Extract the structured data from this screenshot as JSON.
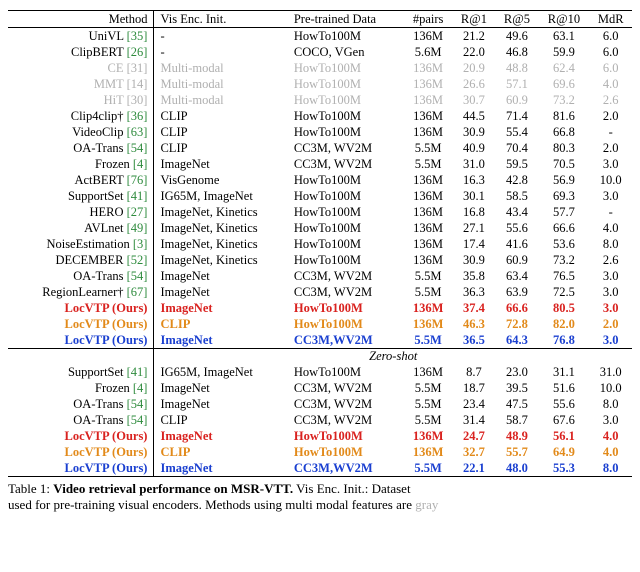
{
  "chart_data": {
    "type": "table",
    "title": "Video retrieval performance on MSR-VTT",
    "columns": [
      "Method",
      "Vis Enc. Init.",
      "Pre-trained Data",
      "#pairs",
      "R@1",
      "R@5",
      "R@10",
      "MdR"
    ],
    "rows_upper": [
      {
        "style": "",
        "method": "UniVL",
        "ref": "[35]",
        "init": "-",
        "data": "HowTo100M",
        "pairs": "136M",
        "r1": "21.2",
        "r5": "49.6",
        "r10": "63.1",
        "mdr": "6.0"
      },
      {
        "style": "",
        "method": "ClipBERT",
        "ref": "[26]",
        "init": "-",
        "data": "COCO, VGen",
        "pairs": "5.6M",
        "r1": "22.0",
        "r5": "46.8",
        "r10": "59.9",
        "mdr": "6.0"
      },
      {
        "style": "gray",
        "method": "CE",
        "ref": "[31]",
        "init": "Multi-modal",
        "data": "HowTo100M",
        "pairs": "136M",
        "r1": "20.9",
        "r5": "48.8",
        "r10": "62.4",
        "mdr": "6.0"
      },
      {
        "style": "gray",
        "method": "MMT",
        "ref": "[14]",
        "init": "Multi-modal",
        "data": "HowTo100M",
        "pairs": "136M",
        "r1": "26.6",
        "r5": "57.1",
        "r10": "69.6",
        "mdr": "4.0"
      },
      {
        "style": "gray",
        "method": "HiT",
        "ref": "[30]",
        "init": "Multi-modal",
        "data": "HowTo100M",
        "pairs": "136M",
        "r1": "30.7",
        "r5": "60.9",
        "r10": "73.2",
        "mdr": "2.6"
      },
      {
        "style": "",
        "method": "Clip4clip†",
        "ref": "[36]",
        "init": "CLIP",
        "data": "HowTo100M",
        "pairs": "136M",
        "r1": "44.5",
        "r5": "71.4",
        "r10": "81.6",
        "mdr": "2.0"
      },
      {
        "style": "",
        "method": "VideoClip",
        "ref": "[63]",
        "init": "CLIP",
        "data": "HowTo100M",
        "pairs": "136M",
        "r1": "30.9",
        "r5": "55.4",
        "r10": "66.8",
        "mdr": "-"
      },
      {
        "style": "",
        "method": "OA-Trans",
        "ref": "[54]",
        "init": "CLIP",
        "data": "CC3M, WV2M",
        "pairs": "5.5M",
        "r1": "40.9",
        "r5": "70.4",
        "r10": "80.3",
        "mdr": "2.0"
      },
      {
        "style": "",
        "method": "Frozen",
        "ref": "[4]",
        "init": "ImageNet",
        "data": "CC3M, WV2M",
        "pairs": "5.5M",
        "r1": "31.0",
        "r5": "59.5",
        "r10": "70.5",
        "mdr": "3.0"
      },
      {
        "style": "",
        "method": "ActBERT",
        "ref": "[76]",
        "init": "VisGenome",
        "data": "HowTo100M",
        "pairs": "136M",
        "r1": "16.3",
        "r5": "42.8",
        "r10": "56.9",
        "mdr": "10.0"
      },
      {
        "style": "",
        "method": "SupportSet",
        "ref": "[41]",
        "init": "IG65M, ImageNet",
        "data": "HowTo100M",
        "pairs": "136M",
        "r1": "30.1",
        "r5": "58.5",
        "r10": "69.3",
        "mdr": "3.0"
      },
      {
        "style": "",
        "method": "HERO",
        "ref": "[27]",
        "init": "ImageNet, Kinetics",
        "data": "HowTo100M",
        "pairs": "136M",
        "r1": "16.8",
        "r5": "43.4",
        "r10": "57.7",
        "mdr": "-"
      },
      {
        "style": "",
        "method": "AVLnet",
        "ref": "[49]",
        "init": "ImageNet, Kinetics",
        "data": "HowTo100M",
        "pairs": "136M",
        "r1": "27.1",
        "r5": "55.6",
        "r10": "66.6",
        "mdr": "4.0"
      },
      {
        "style": "",
        "method": "NoiseEstimation",
        "ref": "[3]",
        "init": "ImageNet, Kinetics",
        "data": "HowTo100M",
        "pairs": "136M",
        "r1": "17.4",
        "r5": "41.6",
        "r10": "53.6",
        "mdr": "8.0"
      },
      {
        "style": "",
        "method": "DECEMBER",
        "ref": "[52]",
        "init": "ImageNet, Kinetics",
        "data": "HowTo100M",
        "pairs": "136M",
        "r1": "30.9",
        "r5": "60.9",
        "r10": "73.2",
        "mdr": "2.6"
      },
      {
        "style": "",
        "method": "OA-Trans",
        "ref": "[54]",
        "init": "ImageNet",
        "data": "CC3M, WV2M",
        "pairs": "5.5M",
        "r1": "35.8",
        "r5": "63.4",
        "r10": "76.5",
        "mdr": "3.0"
      },
      {
        "style": "",
        "method": "RegionLearner†",
        "ref": "[67]",
        "init": "ImageNet",
        "data": "CC3M, WV2M",
        "pairs": "5.5M",
        "r1": "36.3",
        "r5": "63.9",
        "r10": "72.5",
        "mdr": "3.0"
      },
      {
        "style": "red",
        "method": "LocVTP (Ours)",
        "ref": "",
        "init": "ImageNet",
        "data": "HowTo100M",
        "pairs": "136M",
        "r1": "37.4",
        "r5": "66.6",
        "r10": "80.5",
        "mdr": "3.0"
      },
      {
        "style": "orange",
        "method": "LocVTP (Ours)",
        "ref": "",
        "init": "CLIP",
        "data": "HowTo100M",
        "pairs": "136M",
        "r1": "46.3",
        "r5": "72.8",
        "r10": "82.0",
        "mdr": "2.0"
      },
      {
        "style": "blue",
        "method": "LocVTP (Ours)",
        "ref": "",
        "init": "ImageNet",
        "data": "CC3M,WV2M",
        "pairs": "5.5M",
        "r1": "36.5",
        "r5": "64.3",
        "r10": "76.8",
        "mdr": "3.0"
      }
    ],
    "zero_shot_label": "Zero-shot",
    "rows_zeroshot": [
      {
        "style": "",
        "method": "SupportSet",
        "ref": "[41]",
        "init": "IG65M, ImageNet",
        "data": "HowTo100M",
        "pairs": "136M",
        "r1": "8.7",
        "r5": "23.0",
        "r10": "31.1",
        "mdr": "31.0"
      },
      {
        "style": "",
        "method": "Frozen",
        "ref": "[4]",
        "init": "ImageNet",
        "data": "CC3M, WV2M",
        "pairs": "5.5M",
        "r1": "18.7",
        "r5": "39.5",
        "r10": "51.6",
        "mdr": "10.0"
      },
      {
        "style": "",
        "method": "OA-Trans",
        "ref": "[54]",
        "init": "ImageNet",
        "data": "CC3M, WV2M",
        "pairs": "5.5M",
        "r1": "23.4",
        "r5": "47.5",
        "r10": "55.6",
        "mdr": "8.0"
      },
      {
        "style": "",
        "method": "OA-Trans",
        "ref": "[54]",
        "init": "CLIP",
        "data": "CC3M, WV2M",
        "pairs": "5.5M",
        "r1": "31.4",
        "r5": "58.7",
        "r10": "67.6",
        "mdr": "3.0"
      },
      {
        "style": "red",
        "method": "LocVTP (Ours)",
        "ref": "",
        "init": "ImageNet",
        "data": "HowTo100M",
        "pairs": "136M",
        "r1": "24.7",
        "r5": "48.9",
        "r10": "56.1",
        "mdr": "4.0"
      },
      {
        "style": "orange",
        "method": "LocVTP (Ours)",
        "ref": "",
        "init": "CLIP",
        "data": "HowTo100M",
        "pairs": "136M",
        "r1": "32.7",
        "r5": "55.7",
        "r10": "64.9",
        "mdr": "4.0"
      },
      {
        "style": "blue",
        "method": "LocVTP (Ours)",
        "ref": "",
        "init": "ImageNet",
        "data": "CC3M,WV2M",
        "pairs": "5.5M",
        "r1": "22.1",
        "r5": "48.0",
        "r10": "55.3",
        "mdr": "8.0"
      }
    ]
  },
  "headers": {
    "method": "Method",
    "init": "Vis Enc. Init.",
    "data": "Pre-trained Data",
    "pairs": "#pairs",
    "r1": "R@1",
    "r5": "R@5",
    "r10": "R@10",
    "mdr": "MdR"
  },
  "caption": {
    "prefix": "Table 1: ",
    "title": "Video retrieval performance on MSR-VTT.",
    "rest": " Vis Enc. Init.: Dataset"
  },
  "caption_line2": "used for pre-training visual encoders. Methods using multi modal features are "
}
